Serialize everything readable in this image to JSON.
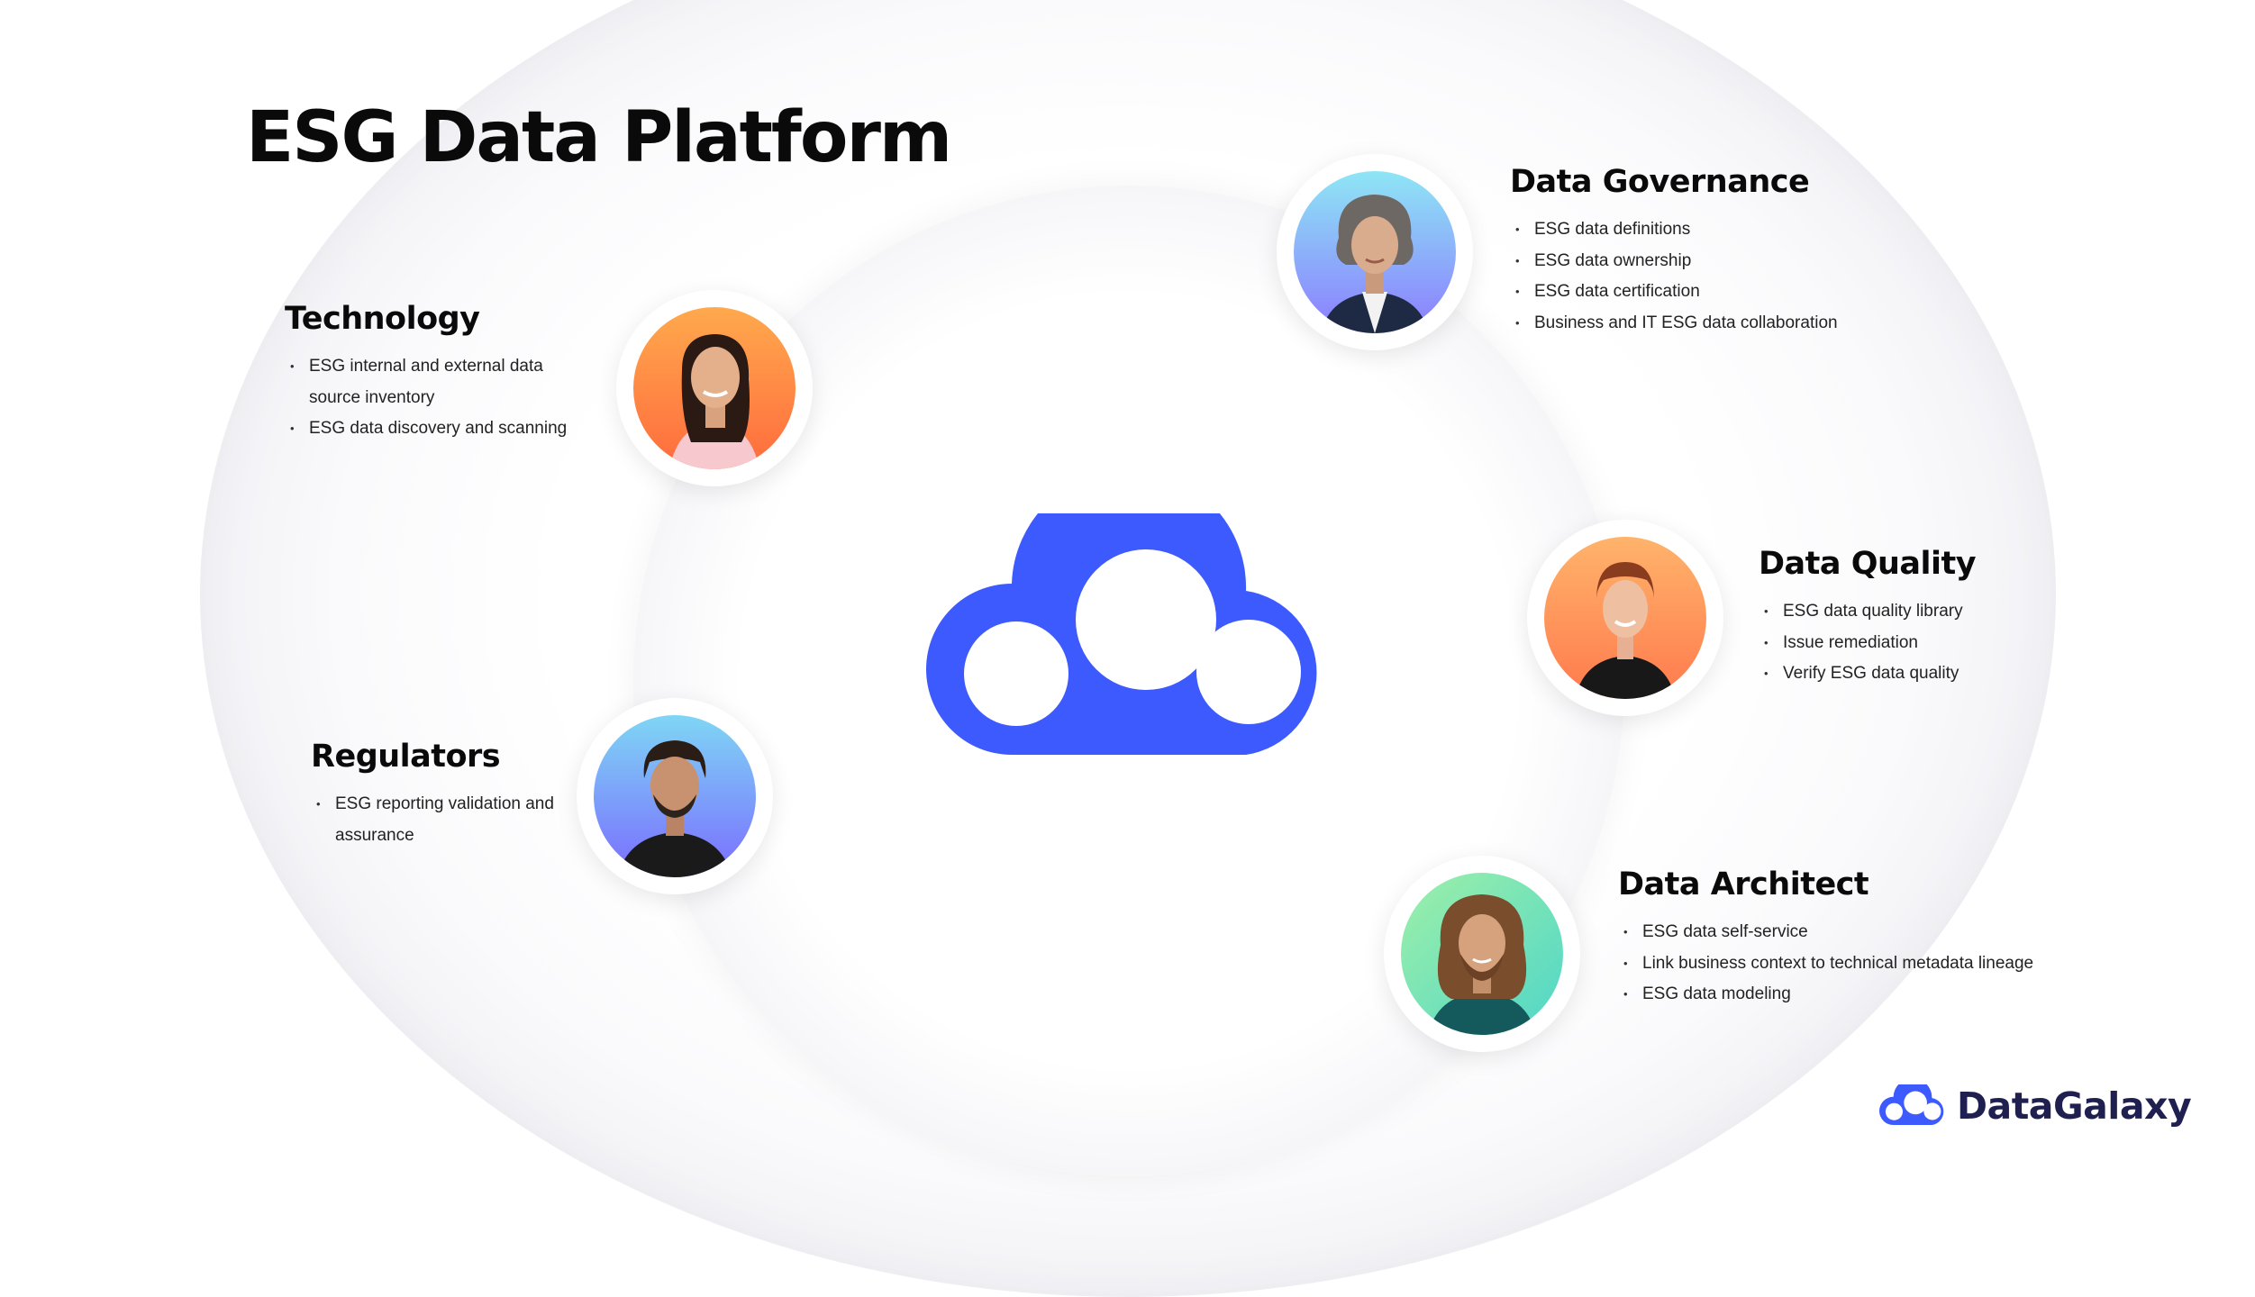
{
  "title": "ESG Data Platform",
  "colors": {
    "accent": "#3d5afe",
    "brand_text": "#1f2050"
  },
  "sections": {
    "technology": {
      "title": "Technology",
      "items": [
        "ESG internal and external data source inventory",
        "ESG data discovery and scanning"
      ]
    },
    "governance": {
      "title": "Data Governance",
      "items": [
        "ESG data definitions",
        "ESG data ownership",
        "ESG data certification",
        "Business and IT ESG data collaboration"
      ]
    },
    "quality": {
      "title": "Data Quality",
      "items": [
        "ESG data quality library",
        "Issue remediation",
        "Verify ESG data quality"
      ]
    },
    "regulators": {
      "title": "Regulators",
      "items": [
        "ESG reporting validation and assurance"
      ]
    },
    "architect": {
      "title": "Data Architect",
      "items": [
        "ESG data self-service",
        "Link business context to technical metadata lineage",
        "ESG data modeling"
      ]
    }
  },
  "brand": {
    "name": "DataGalaxy"
  }
}
